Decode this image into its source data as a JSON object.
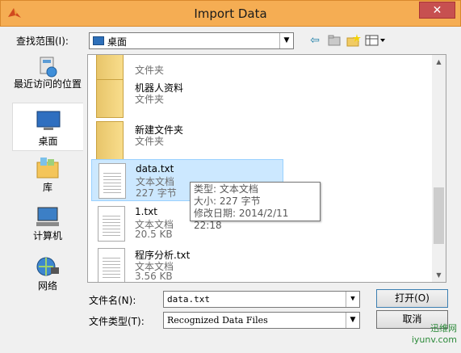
{
  "window": {
    "title": "Import Data",
    "close_glyph": "✕"
  },
  "lookin": {
    "label": "查找范围(I):",
    "value": "桌面"
  },
  "places": [
    {
      "label": "最近访问的位置",
      "icon": "recent-places-icon"
    },
    {
      "label": "桌面",
      "icon": "desktop-icon"
    },
    {
      "label": "库",
      "icon": "libraries-icon"
    },
    {
      "label": "计算机",
      "icon": "computer-icon"
    },
    {
      "label": "网络",
      "icon": "network-icon"
    }
  ],
  "files": [
    {
      "name": "",
      "type": "文件夹",
      "size": "",
      "icon": "folder-icon"
    },
    {
      "name": "机器人资料",
      "type": "文件夹",
      "size": "",
      "icon": "folder-icon"
    },
    {
      "name": "新建文件夹",
      "type": "文件夹",
      "size": "",
      "icon": "folder-icon"
    },
    {
      "name": "data.txt",
      "type": "文本文档",
      "size": "227 字节",
      "icon": "text-document-icon"
    },
    {
      "name": "1.txt",
      "type": "文本文档",
      "size": "20.5 KB",
      "icon": "text-document-icon"
    },
    {
      "name": "程序分析.txt",
      "type": "文本文档",
      "size": "3.56 KB",
      "icon": "text-document-icon"
    }
  ],
  "tooltip": {
    "type_line": "类型: 文本文档",
    "size_line": "大小: 227 字节",
    "date_line": "修改日期: 2014/2/11 22:18"
  },
  "filename": {
    "label": "文件名(N):",
    "value": "data.txt"
  },
  "filetype": {
    "label": "文件类型(T):",
    "value": "Recognized Data Files"
  },
  "buttons": {
    "open": "打开(O)",
    "cancel": "取消"
  },
  "watermark": {
    "line1": "迅维网",
    "line2": "iyunv.com"
  },
  "colors": {
    "titlebar": "#f5ad53",
    "close": "#c75050",
    "selection": "#cce8ff"
  }
}
